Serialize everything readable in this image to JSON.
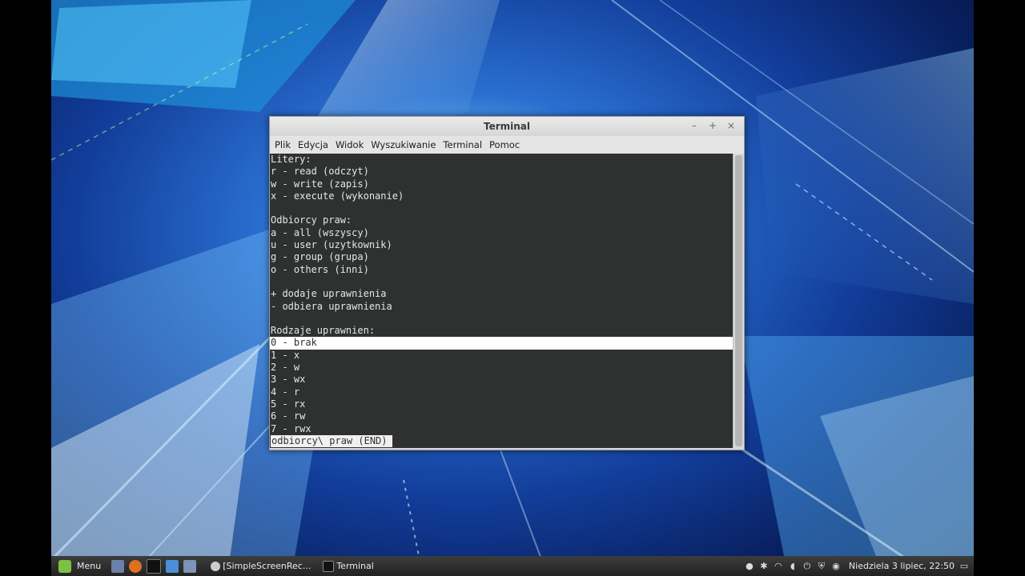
{
  "window": {
    "title": "Terminal",
    "controls": {
      "minimize": "–",
      "maximize": "+",
      "close": "×"
    }
  },
  "menubar": [
    "Plik",
    "Edycja",
    "Widok",
    "Wyszukiwanie",
    "Terminal",
    "Pomoc"
  ],
  "terminal": {
    "lines": [
      "Litery:",
      "r - read (odczyt)",
      "w - write (zapis)",
      "x - execute (wykonanie)",
      "",
      "Odbiorcy praw:",
      "a - all (wszyscy)",
      "u - user (uzytkownik)",
      "g - group (grupa)",
      "o - others (inni)",
      "",
      "+ dodaje uprawnienia",
      "- odbiera uprawnienia",
      "",
      "Rodzaje uprawnien:",
      "0 - brak",
      "1 - x",
      "2 - w",
      "3 - wx",
      "4 - r",
      "5 - rx",
      "6 - rw",
      "7 - rwx"
    ],
    "highlighted_line": 15,
    "status": "odbiorcy\\ praw (END)"
  },
  "taskbar": {
    "menu_label": "Menu",
    "tasks": [
      "[SimpleScreenRec...",
      "Terminal"
    ],
    "clock": "Niedziela 3 lipiec, 22:50"
  },
  "colors": {
    "terminal_bg": "#2f3131",
    "terminal_fg": "#e6e6e6",
    "mint_green": "#7cc242"
  }
}
